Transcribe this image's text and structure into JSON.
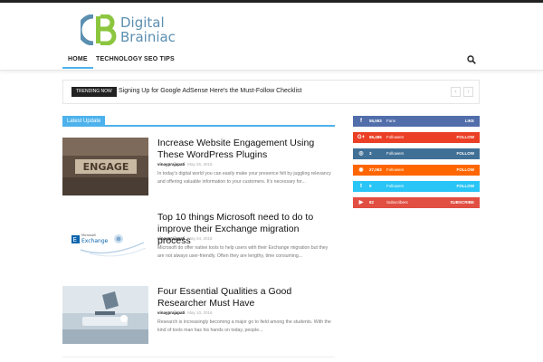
{
  "logo": {
    "line1": "Digital",
    "line2": "Brainiac"
  },
  "nav": {
    "items": [
      "HOME",
      "TECHNOLOGY",
      "SEO TIPS"
    ]
  },
  "ticker": {
    "label": "TRENDING NOW",
    "headline": "Signing Up for Google AdSense Here's the Must-Follow Checklist",
    "prev": "‹",
    "next": "›"
  },
  "section": {
    "title": "Latest Update"
  },
  "articles": [
    {
      "title": "Increase Website Engagement Using These WordPress Plugins",
      "author": "vinayprajapati",
      "date": "May 26, 2016",
      "excerpt": "In today's digital world you can easily make your presence felt by juggling relevancy and offering valuable information to your customers. It's necessary for...",
      "thumb_text": "ENGAGE"
    },
    {
      "title": "Top 10 things Microsoft need to do to improve their Exchange migration process",
      "author": "vinayprajapati",
      "date": "May 24, 2016",
      "excerpt": "Microsoft do offer native tools to help users with their Exchange migration but they are not always user-friendly. Often they are lengthy, time consuming...",
      "thumb_text1": "Microsoft",
      "thumb_text2": "Exchange"
    },
    {
      "title": "Four Essential Qualities a Good Researcher Must Have",
      "author": "vinayprajapati",
      "date": "May 10, 2016",
      "excerpt": "Research is increasingly becoming a major go to field among the students. With the kind of tools man has his hands on today, people..."
    }
  ],
  "social": [
    {
      "icon": "f",
      "count": "55,593",
      "label": "Fans",
      "action": "LIKE",
      "color": "#516eab"
    },
    {
      "icon": "G+",
      "count": "86,485",
      "label": "Followers",
      "action": "FOLLOW",
      "color": "#eb4026"
    },
    {
      "icon": "◎",
      "count": "3",
      "label": "Followers",
      "action": "FOLLOW",
      "color": "#417096"
    },
    {
      "icon": "◉",
      "count": "27,063",
      "label": "Followers",
      "action": "FOLLOW",
      "color": "#ff6600"
    },
    {
      "icon": "t",
      "count": "9",
      "label": "Followers",
      "action": "FOLLOW",
      "color": "#29c5f6"
    },
    {
      "icon": "▶",
      "count": "82",
      "label": "Subscribers",
      "action": "SUBSCRIBE",
      "color": "#e14e42"
    }
  ],
  "colors": {
    "accent": "#4db2ec",
    "logo_green": "#8cc63f",
    "logo_blue": "#5b8fb0"
  }
}
